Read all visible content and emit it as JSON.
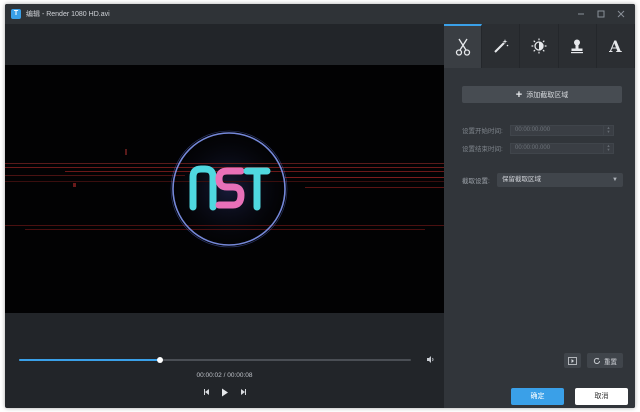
{
  "window": {
    "title": "编辑 - Render 1080 HD.avi",
    "icon_letter": "T",
    "controls": [
      "minimize-icon",
      "maximize-icon",
      "close-icon"
    ]
  },
  "player": {
    "logo_text": "NST",
    "time_text": "00:00:02 / 00:00:08",
    "progress_fraction": 0.36,
    "controls": [
      "prev-frame-icon",
      "play-icon",
      "next-frame-icon"
    ]
  },
  "tabs": [
    {
      "name": "cut",
      "icon": "scissors-icon",
      "active": true
    },
    {
      "name": "effects",
      "icon": "magic-wand-icon",
      "active": false
    },
    {
      "name": "adjust",
      "icon": "brightness-icon",
      "active": false
    },
    {
      "name": "watermark",
      "icon": "stamp-icon",
      "active": false
    },
    {
      "name": "text",
      "icon": "text-a-icon",
      "label": "A",
      "active": false
    }
  ],
  "cut_panel": {
    "add_button": "添加截取区域",
    "start_label": "设置开始时间:",
    "start_value": "00:00:00.000",
    "end_label": "设置结束时间:",
    "end_value": "00:00:00.000",
    "mode_label": "截取设置:",
    "mode_value": "保留截取区域",
    "reset_label": "重置"
  },
  "footer": {
    "ok_label": "确定",
    "cancel_label": "取消"
  },
  "colors": {
    "accent": "#3aa0e8",
    "logo_cyan": "#4fd8e0",
    "logo_pink": "#e870b8",
    "ring": "#8aa0ff"
  }
}
